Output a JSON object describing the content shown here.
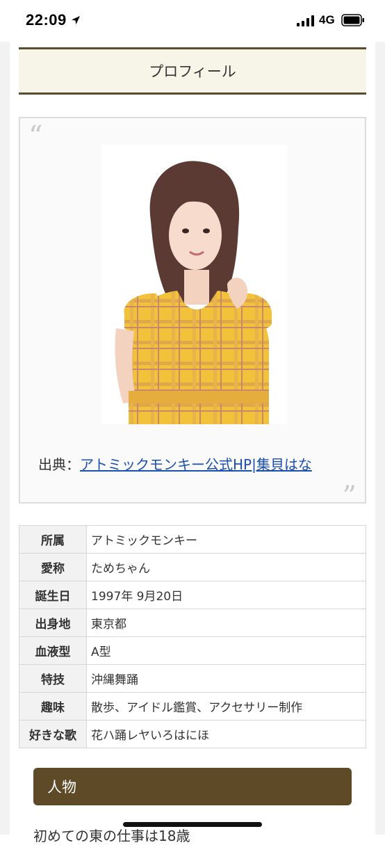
{
  "status_bar": {
    "time": "22:09",
    "network": "4G"
  },
  "profile": {
    "heading": "プロフィール",
    "quote": {
      "open_mark": "“",
      "close_mark": "”",
      "source_prefix": "出典：",
      "source_link": "アトミックモンキー公式HP|集貝はな"
    },
    "table": [
      {
        "label": "所属",
        "value": "アトミックモンキー"
      },
      {
        "label": "愛称",
        "value": "ためちゃん"
      },
      {
        "label": "誕生日",
        "value": "1997年 9月20日"
      },
      {
        "label": "出身地",
        "value": "東京都"
      },
      {
        "label": "血液型",
        "value": "A型"
      },
      {
        "label": "特技",
        "value": "沖縄舞踊"
      },
      {
        "label": "趣味",
        "value": "散歩、アイドル鑑賞、アクセサリー制作"
      },
      {
        "label": "好きな歌",
        "value": "花ハ踊レヤいろはにほ"
      }
    ]
  },
  "person_section": {
    "heading": "人物",
    "text": "初めての東の仕事は18歳"
  },
  "colors": {
    "heading_border": "#5a4a2e",
    "section_bg": "#5e4a26",
    "link": "#1a4fb0"
  }
}
